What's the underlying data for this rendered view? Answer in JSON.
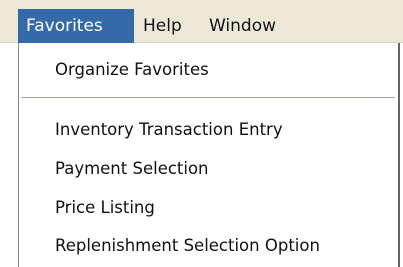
{
  "menubar": {
    "items": [
      {
        "label": "Favorites",
        "active": true
      },
      {
        "label": "Help",
        "active": false
      },
      {
        "label": "Window",
        "active": false
      }
    ]
  },
  "dropdown": {
    "items": [
      {
        "label": "Organize Favorites"
      },
      {
        "label": "Inventory Transaction Entry"
      },
      {
        "label": "Payment Selection"
      },
      {
        "label": "Price Listing"
      },
      {
        "label": "Replenishment Selection Option"
      }
    ]
  },
  "colors": {
    "menubar_bg": "#ece9d8",
    "active_menu_bg": "#356aa8",
    "active_menu_text": "#ffffff",
    "dropdown_bg": "#ffffff"
  }
}
